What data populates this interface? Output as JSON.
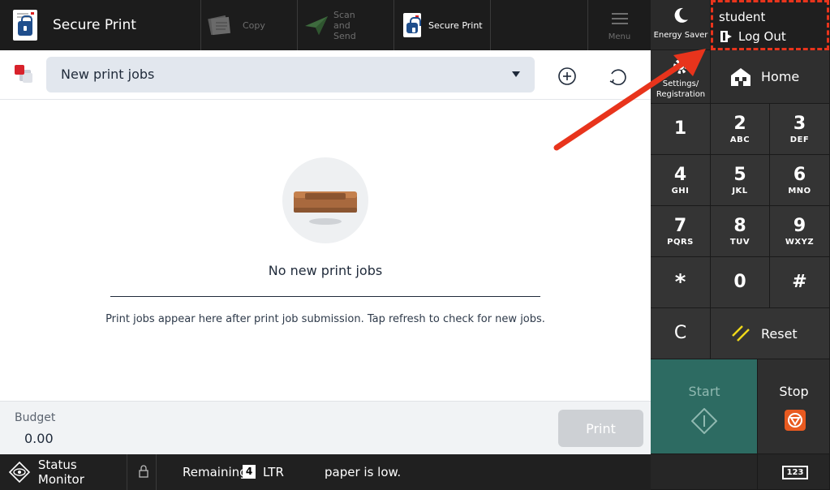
{
  "topbar": {
    "app_title": "Secure Print",
    "tabs": [
      {
        "label": "Copy"
      },
      {
        "label": "Scan and Send"
      },
      {
        "label": "Secure Print"
      }
    ],
    "menu_label": "Menu"
  },
  "header": {
    "dropdown_value": "New print jobs"
  },
  "empty_state": {
    "title": "No new print jobs",
    "message": "Print jobs appear here after print job submission. Tap refresh to check for new jobs."
  },
  "budget": {
    "label": "Budget",
    "value": "0.00"
  },
  "print_button": "Print",
  "status_bar": {
    "status_monitor": "Status Monitor",
    "remaining_label": "Remaining",
    "remaining_count": "4",
    "paper_size": "LTR",
    "message": "paper is low."
  },
  "side": {
    "energy_saver": "Energy Saver",
    "user": "student",
    "logout": "Log Out",
    "settings": "Settings/ Registration",
    "home": "Home",
    "keys": [
      {
        "num": "1",
        "sub": ""
      },
      {
        "num": "2",
        "sub": "ABC"
      },
      {
        "num": "3",
        "sub": "DEF"
      },
      {
        "num": "4",
        "sub": "GHI"
      },
      {
        "num": "5",
        "sub": "JKL"
      },
      {
        "num": "6",
        "sub": "MNO"
      },
      {
        "num": "7",
        "sub": "PQRS"
      },
      {
        "num": "8",
        "sub": "TUV"
      },
      {
        "num": "9",
        "sub": "WXYZ"
      },
      {
        "num": "*",
        "sub": ""
      },
      {
        "num": "0",
        "sub": ""
      },
      {
        "num": "#",
        "sub": ""
      }
    ],
    "clear": "C",
    "reset": "Reset",
    "start": "Start",
    "stop": "Stop",
    "keypad_toggle": "123"
  },
  "colors": {
    "accent_red": "#e8341c",
    "start_teal": "#2d6b62",
    "stop_orange": "#e85a20"
  }
}
